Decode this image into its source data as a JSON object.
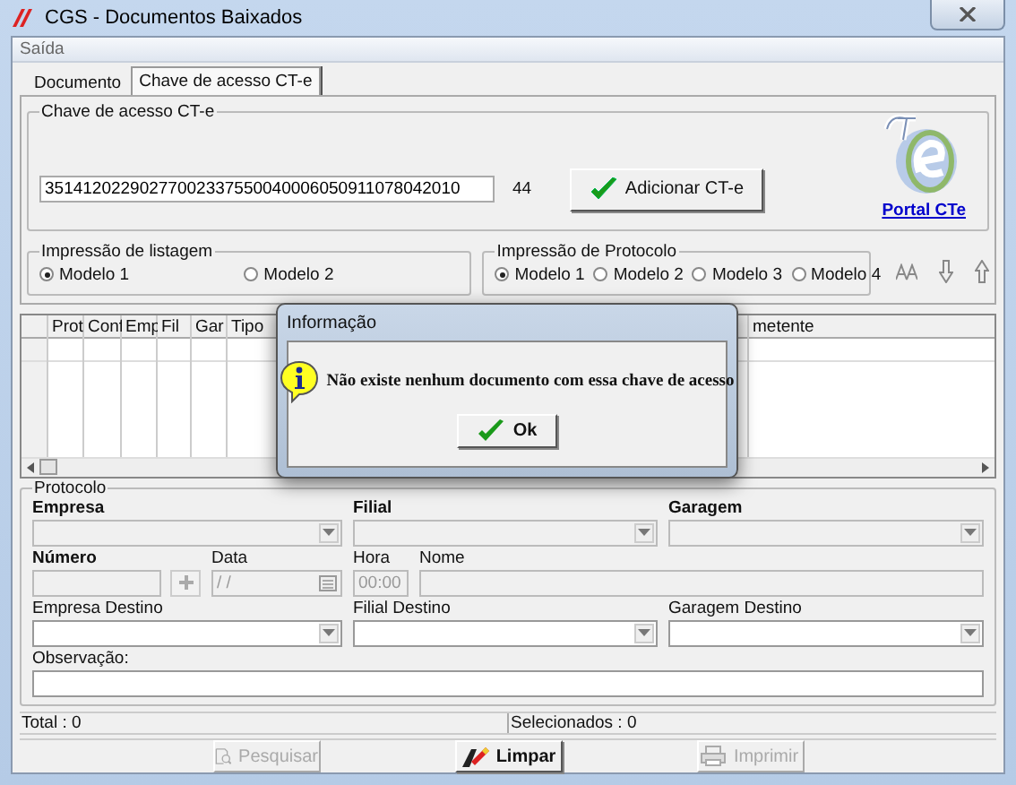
{
  "window": {
    "title": "CGS - Documentos Baixados"
  },
  "menu": [
    "Saída"
  ],
  "tabs": [
    {
      "label": "Documento",
      "selected": false
    },
    {
      "label": "Chave de acesso CT-e",
      "selected": true
    }
  ],
  "chave": {
    "legend": "Chave de acesso CT-e",
    "value": "35141202290277002337550040006050911078042010",
    "count": "44",
    "button": "Adicionar CT-e",
    "link": "Portal CTe"
  },
  "impressao_listagem": {
    "legend": "Impressão de listagem",
    "options": [
      {
        "label": "Modelo 1",
        "selected": true
      },
      {
        "label": "Modelo 2",
        "selected": false
      }
    ]
  },
  "impressao_protocolo": {
    "legend": "Impressão de Protocolo",
    "options": [
      {
        "label": "Modelo 1",
        "selected": true
      },
      {
        "label": "Modelo 2",
        "selected": false
      },
      {
        "label": "Modelo 3",
        "selected": false
      },
      {
        "label": "Modelo 4",
        "selected": false
      }
    ]
  },
  "grid": {
    "columns": [
      "Prot",
      "Conf",
      "Emp",
      "Fil",
      "Gar",
      "Tipo",
      "metente"
    ]
  },
  "protocolo": {
    "legend": "Protocolo",
    "fields": [
      {
        "label": "Empresa",
        "bold": true,
        "kind": "combo",
        "disabled": true
      },
      {
        "label": "Filial",
        "bold": true,
        "kind": "combo",
        "disabled": true
      },
      {
        "label": "Garagem",
        "bold": true,
        "kind": "combo",
        "disabled": true
      },
      {
        "label": "Número",
        "bold": true,
        "kind": "lookup",
        "disabled": true
      },
      {
        "label": "Data",
        "bold": false,
        "kind": "date",
        "disabled": true,
        "value": "/ /"
      },
      {
        "label": "Hora",
        "bold": false,
        "kind": "text",
        "disabled": true,
        "value": "00:00"
      },
      {
        "label": "Nome",
        "bold": false,
        "kind": "text",
        "disabled": true
      },
      {
        "label": "Empresa Destino",
        "bold": false,
        "kind": "combo",
        "disabled": false
      },
      {
        "label": "Filial Destino",
        "bold": false,
        "kind": "combo",
        "disabled": false
      },
      {
        "label": "Garagem Destino",
        "bold": false,
        "kind": "combo",
        "disabled": false
      },
      {
        "label": "Observação:",
        "bold": false,
        "kind": "text",
        "disabled": false
      }
    ]
  },
  "status": [
    "Total : 0",
    "Selecionados : 0"
  ],
  "buttons": [
    {
      "label": "Pesquisar",
      "kind": "search",
      "disabled": true
    },
    {
      "label": "Limpar",
      "kind": "clear",
      "disabled": false
    },
    {
      "label": "Imprimir",
      "kind": "print",
      "disabled": true
    }
  ],
  "dialog": {
    "title": "Informação",
    "message": "Não existe nenhum documento com essa chave de acesso",
    "button": "Ok"
  }
}
